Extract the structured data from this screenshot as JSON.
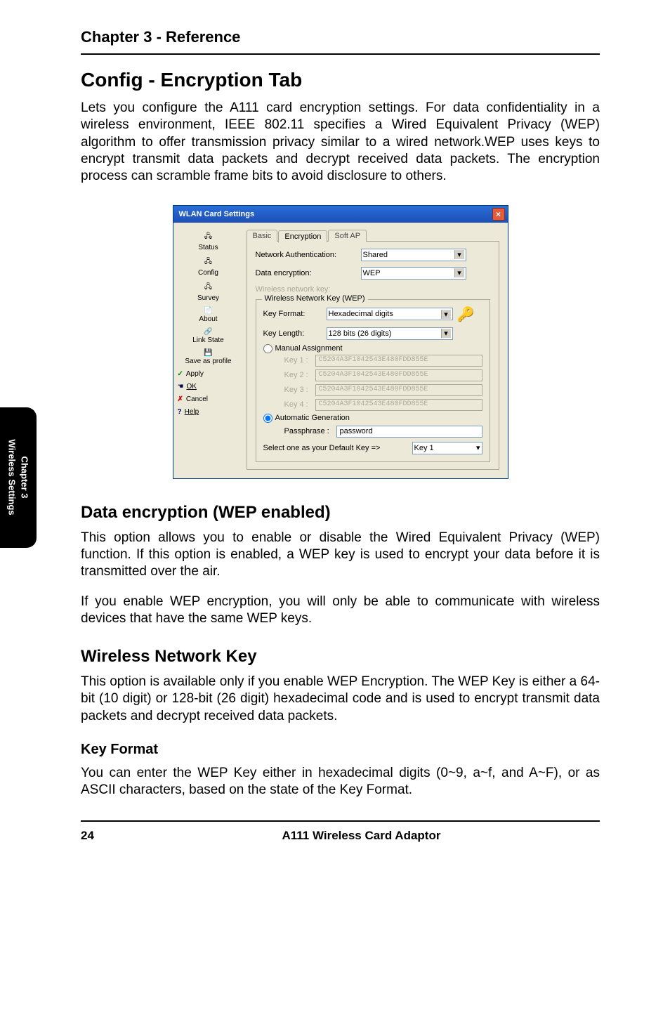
{
  "header": {
    "chapter_title": "Chapter 3 - Reference"
  },
  "title": "Config - Encryption Tab",
  "intro": "Lets you configure the A111 card encryption settings. For data confidentiality in a wireless environment, IEEE 802.11 specifies a Wired Equivalent Privacy (WEP) algorithm to offer transmission privacy similar to a wired network.WEP uses keys to encrypt transmit data packets and decrypt received data packets. The encryption process can scramble frame bits to avoid disclosure to others.",
  "sections": {
    "data_enc": {
      "heading": "Data encryption (WEP enabled)",
      "p1": "This option allows you to enable or disable the Wired Equivalent Privacy (WEP) function. If this option is enabled, a WEP key is used to encrypt your data before it is transmitted over the air.",
      "p2": "If you enable WEP encryption, you will only be able to communicate with wireless devices that have the same WEP keys."
    },
    "wnk": {
      "heading": "Wireless Network Key",
      "p": "This option is available only if you enable WEP Encryption. The WEP Key is either a 64-bit (10 digit) or 128-bit (26 digit) hexadecimal  code and is used to encrypt transmit data packets and decrypt received data packets."
    },
    "keyformat": {
      "heading": "Key Format",
      "p": "You can enter the WEP Key either in hexadecimal digits (0~9, a~f, and A~F), or as ASCII characters, based on the state of the Key Format."
    }
  },
  "side_tab": {
    "line1": "Chapter 3",
    "line2": "Wireless Settings"
  },
  "footer": {
    "page_num": "24",
    "title": "A111 Wireless Card Adaptor"
  },
  "dialog": {
    "title": "WLAN Card Settings",
    "close": "×",
    "sidebar": {
      "status": "Status",
      "config": "Config",
      "survey": "Survey",
      "about": "About",
      "link_state": "Link State",
      "save": "Save as profile",
      "apply_tick": "✓",
      "apply": "Apply",
      "ok_icon": "☚",
      "ok": "OK",
      "cancel_icon": "✗",
      "cancel": "Cancel",
      "help_icon": "?",
      "help": "Help"
    },
    "tabs": {
      "basic": "Basic",
      "encryption": "Encryption",
      "softap": "Soft AP"
    },
    "form": {
      "net_auth_label": "Network Authentication:",
      "net_auth_value": "Shared",
      "data_enc_label": "Data encryption:",
      "data_enc_value": "WEP",
      "wnk_disabled": "Wireless network key:",
      "legend": "Wireless Network Key (WEP)",
      "key_format_label": "Key Format:",
      "key_format_value": "Hexadecimal digits",
      "key_length_label": "Key Length:",
      "key_length_value": "128 bits (26 digits)",
      "manual_label": "Manual Assignment",
      "key1_label": "Key 1 :",
      "key2_label": "Key 2 :",
      "key3_label": "Key 3 :",
      "key4_label": "Key 4 :",
      "key1_val": "C5204A3F1042543E480FDD855E",
      "key2_val": "C5204A3F1042543E480FDD855E",
      "key3_val": "C5204A3F1042543E480FDD855E",
      "key4_val": "C5204A3F1042543E480FDD855E",
      "auto_label": "Automatic Generation",
      "pass_label": "Passphrase :",
      "pass_value": "password",
      "default_label": "Select one as your Default Key =>",
      "default_value": "Key 1"
    }
  }
}
